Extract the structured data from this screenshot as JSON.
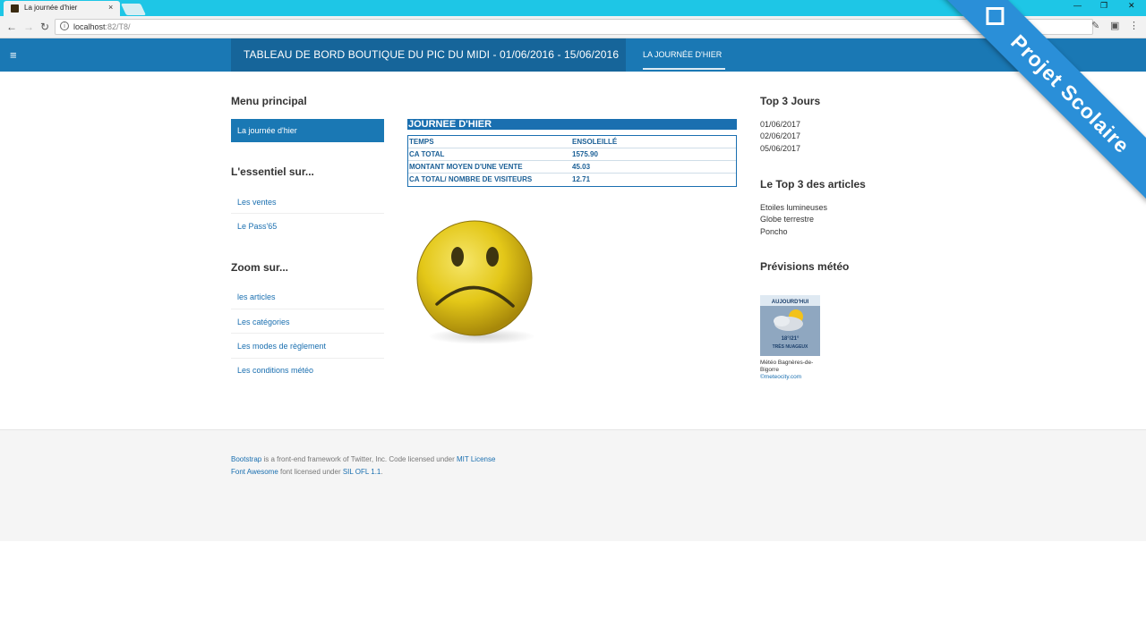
{
  "browser": {
    "tab_title": "La journée d'hier",
    "tab_close": "×",
    "url_host": "localhost",
    "url_rest": ":82/T8/",
    "window_controls": [
      "—",
      "❐",
      "✕"
    ],
    "icons": [
      "back-icon",
      "forward-icon",
      "reload-icon",
      "info-icon",
      "extension-icon",
      "cast-icon",
      "menu-dots-icon"
    ]
  },
  "navbar": {
    "menu_icon": "≡",
    "brand": "TABLEAU DE BORD BOUTIQUE DU PIC DU MIDI - 01/06/2016 - 15/06/2016",
    "active_link": "LA JOURNÉE D'HIER",
    "color": "#1a78b4"
  },
  "ribbon": {
    "text": "Projet Scolaire",
    "color": "#2a8fd8"
  },
  "sidebar": {
    "main_heading": "Menu principal",
    "active_item": "La journée d'hier",
    "essentiel_heading": "L'essentiel sur...",
    "essentiel_items": [
      "Les ventes",
      "Le Pass'65"
    ],
    "zoom_heading": "Zoom sur...",
    "zoom_items": [
      "les articles",
      "Les catégories",
      "Les modes de règlement",
      "Les conditions météo"
    ]
  },
  "journee": {
    "title": "JOURNEE D'HIER",
    "rows": [
      {
        "label": "TEMPS",
        "value": "ENSOLEILLÉ"
      },
      {
        "label": "CA TOTAL",
        "value": "1575.90"
      },
      {
        "label": "MONTANT MOYEN D'UNE VENTE",
        "value": "45.03"
      },
      {
        "label": "CA TOTAL/ NOMBRE DE VISITEURS",
        "value": "12.71"
      }
    ],
    "mood_icon": "sad-smiley-icon"
  },
  "right": {
    "top_days_heading": "Top 3 Jours",
    "top_days": [
      "01/06/2017",
      "02/06/2017",
      "05/06/2017"
    ],
    "top_articles_heading": "Le Top 3 des articles",
    "top_articles": [
      "Etoiles lumineuses",
      "Globe terrestre",
      "Poncho"
    ],
    "meteo_heading": "Prévisions météo",
    "meteo_widget_day": "AUJOURD'HUI",
    "meteo_widget_temp": "18°/21°",
    "meteo_widget_desc": "TRÈS NUAGEUX",
    "meteo_caption_1": "Météo Bagnères-de-",
    "meteo_caption_2": "Bigorre",
    "meteo_link": "©meteocity.com"
  },
  "footer": {
    "line1_link1": "Bootstrap",
    "line1_text": " is a front-end framework of Twitter, Inc. Code licensed under ",
    "line1_link2": "MIT License",
    "line2_link1": "Font Awesome",
    "line2_text": " font licensed under ",
    "line2_link2": "SIL OFL 1.1",
    "line2_end": "."
  }
}
